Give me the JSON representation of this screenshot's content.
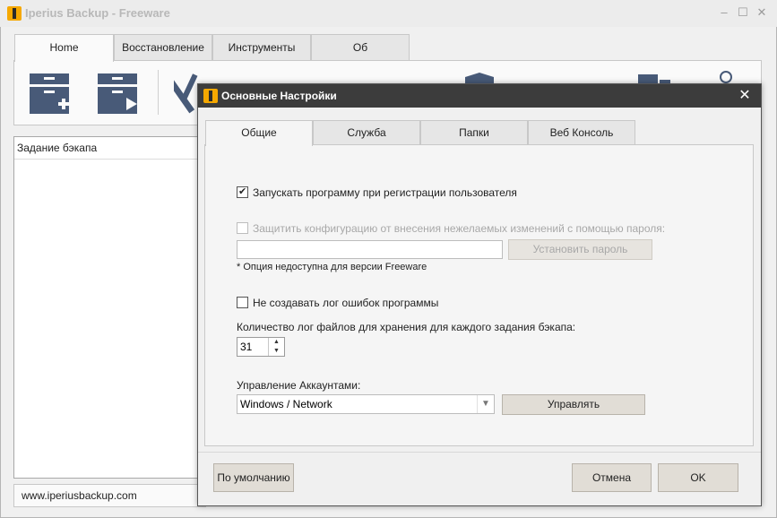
{
  "app": {
    "title": "Iperius Backup - Freeware",
    "window_controls": [
      "–",
      "☐",
      "✕"
    ],
    "tabs": [
      {
        "label": "Home",
        "active": true
      },
      {
        "label": "Восстановление",
        "active": false
      },
      {
        "label": "Инструменты",
        "active": false
      },
      {
        "label": "Об",
        "active": false
      }
    ],
    "job_list_header": "Задание бэкапа",
    "status_url": "www.iperiusbackup.com",
    "colors": {
      "toolbar_icon": "#485a78",
      "logo": "#f5a800",
      "dialog_title_bg": "#3c3c3c"
    }
  },
  "dialog": {
    "title": "Основные Настройки",
    "close_glyph": "✕",
    "tabs": [
      {
        "label": "Общие",
        "active": true
      },
      {
        "label": "Служба",
        "active": false
      },
      {
        "label": "Папки",
        "active": false
      },
      {
        "label": "Веб Консоль",
        "active": false
      }
    ],
    "general": {
      "run_on_login_label": "Запускать программу при регистрации пользователя",
      "run_on_login_checked": true,
      "protect_config_label": "Защитить конфигурацию от внесения нежелаемых изменений с помощью пароля:",
      "protect_config_checked": false,
      "password_value": "",
      "set_password_button": "Установить пароль",
      "freeware_note": "* Опция недоступна для версии Freeware",
      "no_error_log_label": "Не создавать лог ошибок программы",
      "no_error_log_checked": false,
      "log_count_label": "Количество лог файлов для хранения для каждого задания бэкапа:",
      "log_count_value": "31",
      "accounts_label": "Управление Аккаунтами:",
      "accounts_selected": "Windows / Network",
      "manage_button": "Управлять"
    },
    "footer": {
      "default_button": "По умолчанию",
      "cancel_button": "Отмена",
      "ok_button": "OK"
    }
  }
}
